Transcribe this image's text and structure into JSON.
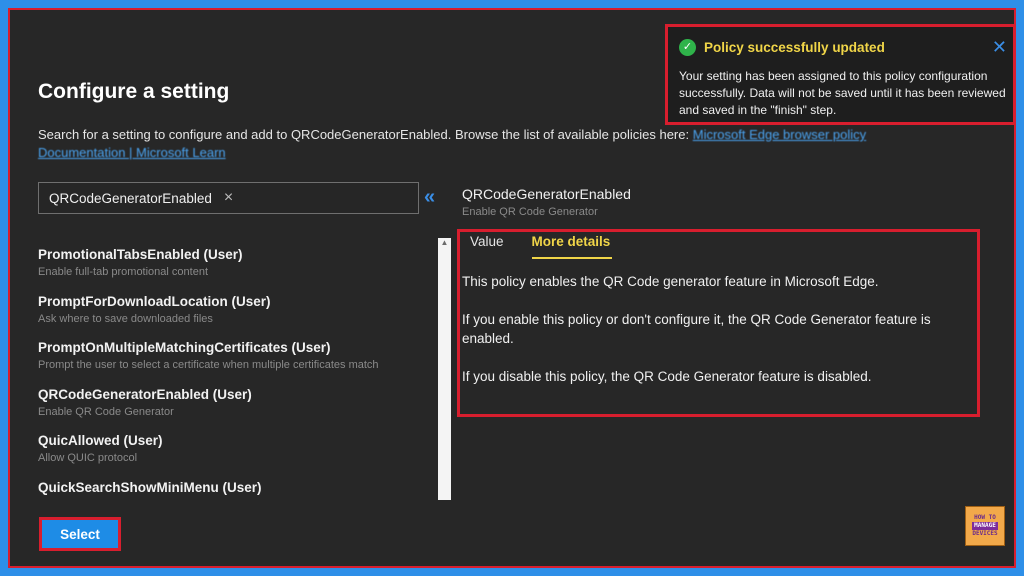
{
  "page": {
    "title": "Configure a setting",
    "description": "Search for a setting to configure and add to QRCodeGeneratorEnabled. Browse the list of available policies here:",
    "desc_link_1": "Microsoft Edge browser policy",
    "desc_link_2": "Documentation | Microsoft Learn"
  },
  "search": {
    "value": "QRCodeGeneratorEnabled",
    "clear_icon": "×",
    "collapse_icon": "«"
  },
  "settings": [
    {
      "name": "PromotionalTabsEnabled (User)",
      "desc": "Enable full-tab promotional content"
    },
    {
      "name": "PromptForDownloadLocation (User)",
      "desc": "Ask where to save downloaded files"
    },
    {
      "name": "PromptOnMultipleMatchingCertificates (User)",
      "desc": "Prompt the user to select a certificate when multiple certificates match"
    },
    {
      "name": "QRCodeGeneratorEnabled (User)",
      "desc": "Enable QR Code Generator"
    },
    {
      "name": "QuicAllowed (User)",
      "desc": "Allow QUIC protocol"
    },
    {
      "name": "QuickSearchShowMiniMenu (User)",
      "desc": ""
    }
  ],
  "select_button": "Select",
  "detail": {
    "title": "QRCodeGeneratorEnabled",
    "subtitle": "Enable QR Code Generator",
    "tabs": [
      "Value",
      "More details"
    ],
    "active_tab": "More details",
    "paragraphs": [
      "This policy enables the QR Code generator feature in Microsoft Edge.",
      "If you enable this policy or don't configure it, the QR Code Generator feature is enabled.",
      "If you disable this policy, the QR Code Generator feature is disabled."
    ]
  },
  "toast": {
    "title": "Policy successfully updated",
    "message": "Your setting has been assigned to this policy configuration successfully. Data will not be saved until it has been reviewed and saved in the \"finish\" step.",
    "success_icon": "check-circle-icon",
    "close_icon": "close-icon"
  },
  "logo": {
    "line1": "HOW TO",
    "line2": "MANAGE",
    "line3": "DEVICES"
  },
  "colors": {
    "accent": "#1e8ce6",
    "highlight": "#f0d548",
    "success": "#2fb34a",
    "annotation": "#d81e2e"
  }
}
